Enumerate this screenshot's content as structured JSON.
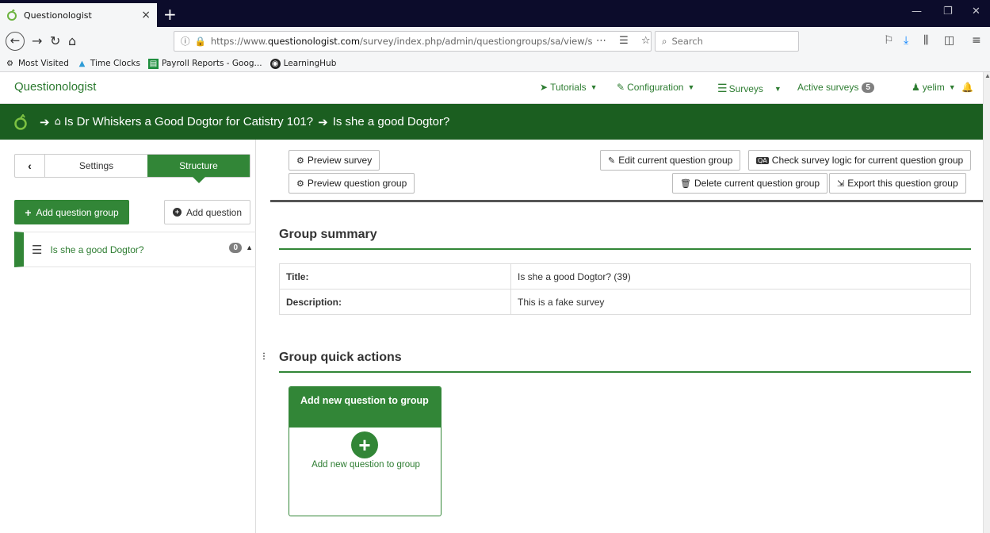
{
  "browser": {
    "tab_title": "Questionologist",
    "tab_close": "×",
    "new_tab": "+",
    "url_prefix": "https://www.",
    "url_host": "questionologist.com",
    "url_path": "/survey/index.php/admin/questiongroups/sa/view/s",
    "url_actions": "⋯ ☰ ☆",
    "search_placeholder": "Search",
    "bookmarks": [
      {
        "label": "Most Visited",
        "icon": "gear-icon"
      },
      {
        "label": "Time Clocks",
        "icon": "drop-icon"
      },
      {
        "label": "Payroll Reports - Goog...",
        "icon": "sheet-icon"
      },
      {
        "label": "LearningHub",
        "icon": "circle-logo-icon"
      }
    ]
  },
  "app": {
    "brand": "Questionologist",
    "nav": {
      "tutorials": "Tutorials",
      "configuration": "Configuration",
      "surveys": "Surveys",
      "active_surveys": "Active surveys",
      "active_count": "5",
      "user": "yelim"
    },
    "breadcrumb": {
      "survey": "Is Dr Whiskers a Good Dogtor for Catistry 101?",
      "group": "Is she a good Dogtor?"
    }
  },
  "sidebar": {
    "tabs": [
      "Settings",
      "Structure"
    ],
    "add_group": "Add question group",
    "add_question": "Add question",
    "group_item": "Is she a good Dogtor?",
    "group_count": "0"
  },
  "toolbar": {
    "preview_survey": "Preview survey",
    "preview_group": "Preview question group",
    "edit_group": "Edit current question group",
    "check_logic": "Check survey logic for current question group",
    "delete_group": "Delete current question group",
    "export_group": "Export this question group"
  },
  "summary": {
    "heading": "Group summary",
    "rows": [
      {
        "key": "Title:",
        "value": "Is she a good Dogtor? (39)"
      },
      {
        "key": "Description:",
        "value": "This is a fake survey"
      }
    ]
  },
  "quick_actions": {
    "heading": "Group quick actions",
    "card_title": "Add new question to group",
    "card_label": "Add new question to group"
  },
  "colors": {
    "primary_green": "#328637",
    "dark_green": "#1b5e20",
    "badge_gray": "#7f7f7f"
  }
}
